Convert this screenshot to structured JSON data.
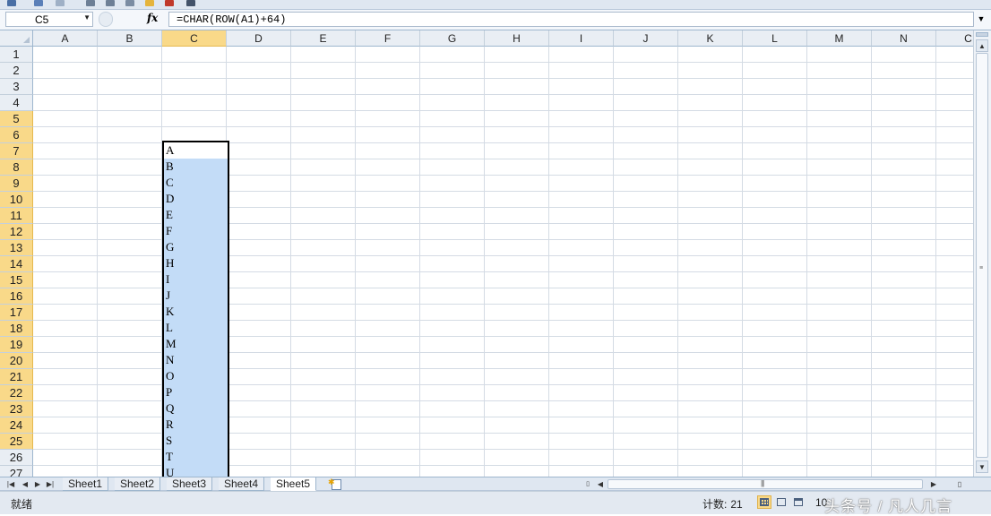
{
  "namebox": {
    "value": "C5"
  },
  "formula_bar": {
    "fx_label": "fx",
    "formula": "=CHAR(ROW(A1)+64)"
  },
  "columns": [
    "A",
    "B",
    "C",
    "D",
    "E",
    "F",
    "G",
    "H",
    "I",
    "J",
    "K",
    "L",
    "M",
    "N",
    "C"
  ],
  "selected_column": "C",
  "rows": [
    "1",
    "2",
    "3",
    "4",
    "5",
    "6",
    "7",
    "8",
    "9",
    "10",
    "11",
    "12",
    "13",
    "14",
    "15",
    "16",
    "17",
    "18",
    "19",
    "20",
    "21",
    "22",
    "23",
    "24",
    "25",
    "26",
    "27"
  ],
  "selected_rows": [
    "5",
    "25"
  ],
  "cells_c": [
    "A",
    "B",
    "C",
    "D",
    "E",
    "F",
    "G",
    "H",
    "I",
    "J",
    "K",
    "L",
    "M",
    "N",
    "O",
    "P",
    "Q",
    "R",
    "S",
    "T",
    "U"
  ],
  "sheet_tabs": [
    "Sheet1",
    "Sheet2",
    "Sheet3",
    "Sheet4",
    "Sheet5"
  ],
  "active_sheet": "Sheet5",
  "status": {
    "ready": "就绪",
    "count_label": "计数:",
    "count_value": "21",
    "zoom": "10"
  },
  "watermark": "头条号 / 凡人几言",
  "colors": {
    "selection_fill": "#c3dcf7",
    "header_highlight": "#f9d989",
    "header_bg": "#e9eef4",
    "gridline": "#d4dbe4"
  },
  "icons": [
    "dropdown-arrow-icon",
    "fx-icon",
    "formula-expand-icon",
    "select-all-icon",
    "autofill-options-icon",
    "new-sheet-icon",
    "scroll-up-icon",
    "scroll-down-icon",
    "scroll-left-icon",
    "scroll-right-icon",
    "normal-view-icon",
    "page-layout-view-icon",
    "page-break-view-icon"
  ]
}
